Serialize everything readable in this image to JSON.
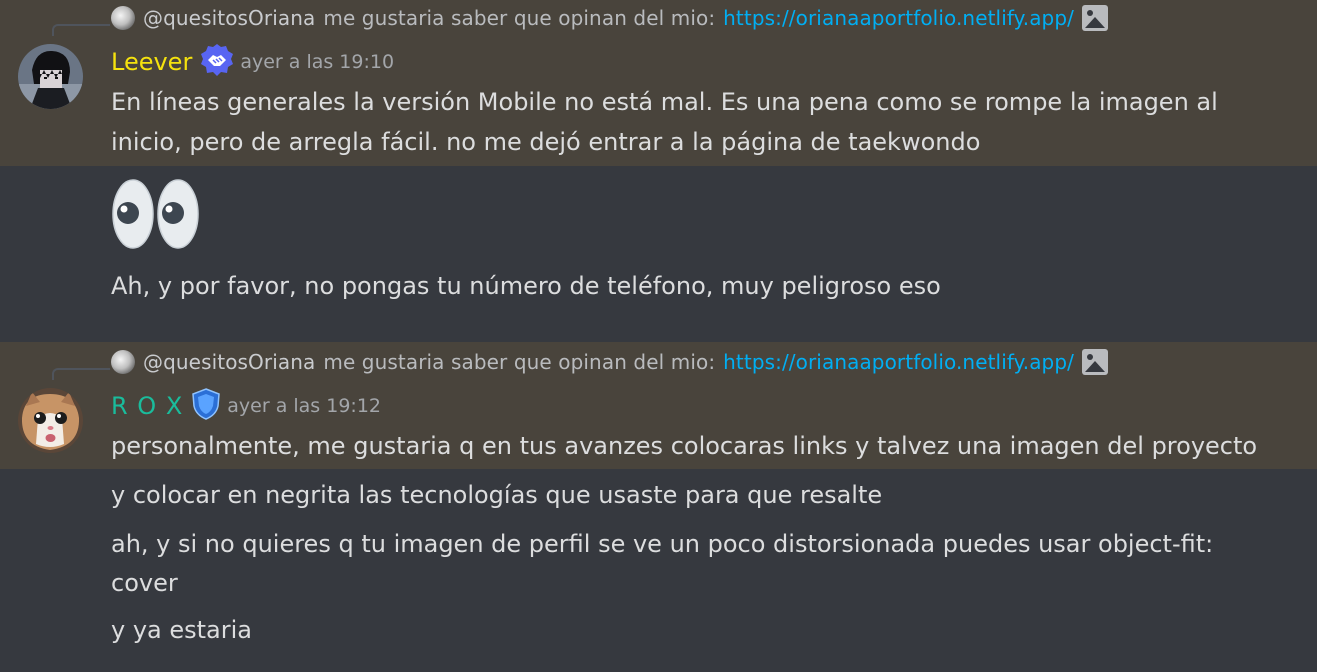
{
  "messages": [
    {
      "reply": {
        "author": "@quesitosOriana",
        "text": "me gustaria saber que opinan del mio:",
        "link": "https://orianaaportfolio.netlify.app/",
        "image_icon": "image-icon"
      },
      "author": "Leever",
      "author_color": "#f5e20e",
      "badge_icon": "handshake-badge-icon",
      "timestamp": "ayer a las 19:10",
      "lines": [
        "En líneas generales la versión Mobile no está mal. Es una pena como se rompe la imagen al",
        "inicio, pero de arregla fácil. no me dejó entrar a la página de taekwondo"
      ],
      "followups": [
        {
          "emoji": "eyes-emoji"
        },
        {
          "text": "Ah, y por favor, no pongas tu número de teléfono, muy peligroso eso"
        }
      ]
    },
    {
      "reply": {
        "author": "@quesitosOriana",
        "text": "me gustaria saber que opinan del mio:",
        "link": "https://orianaaportfolio.netlify.app/",
        "image_icon": "image-icon"
      },
      "author": "R O X",
      "author_color": "#1abc9c",
      "badge_icon": "shield-badge-icon",
      "timestamp": "ayer a las 19:12",
      "lines": [
        "personalmente, me gustaria q en tus avanzes colocaras links y talvez una imagen del proyecto"
      ],
      "followups": [
        {
          "text": "y colocar en negrita las tecnologías que usaste para que resalte"
        },
        {
          "text": "ah, y si no quieres q tu imagen de perfil se ve un poco distorsionada puedes usar object-fit:"
        },
        {
          "text": "cover"
        },
        {
          "text": "y ya estaria"
        }
      ]
    }
  ],
  "colors": {
    "background": "#36393f",
    "mention_highlight": "#49443c",
    "link": "#00aff4"
  }
}
